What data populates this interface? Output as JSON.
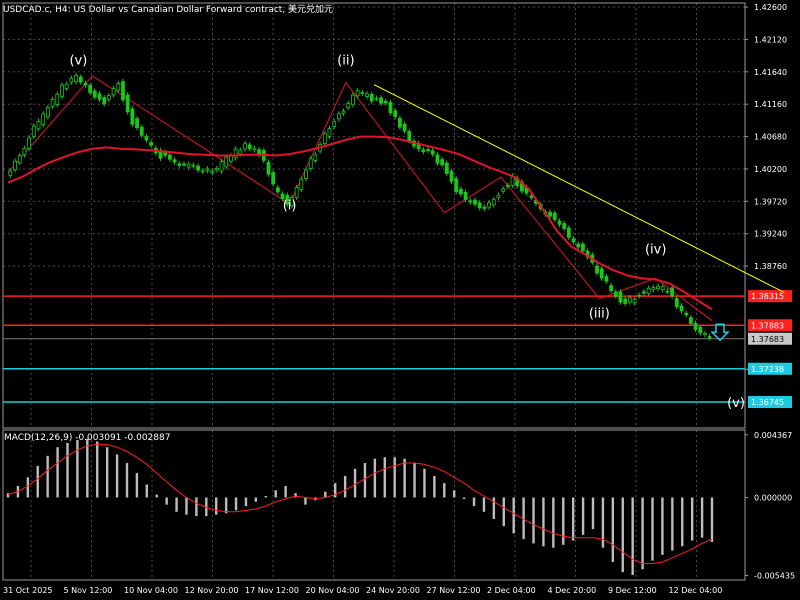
{
  "symbol_header": "USDCAD.c, H4:  US Dollar vs Canadian Dollar Forward contract, 美元兑加元",
  "macd_header": "MACD(12,26,9) -0.003091 -0.002887",
  "colors": {
    "background": "#000000",
    "grid": "#4a4a4a",
    "candles": "#19c819",
    "ma": "#e0142a",
    "wave_lines": "#e0142a",
    "trendline": "#ffff00",
    "resistance_lines": "#ff2020",
    "support_lines": "#1ecbe1",
    "macd_hist": "#bdbdbd",
    "macd_signal": "#ff2020",
    "axis_text": "#ffffff",
    "arrow": "#1ecbe1"
  },
  "chart_data": [
    {
      "type": "candlestick",
      "title": "USDCAD.c, H4:  US Dollar vs Canadian Dollar Forward contract, 美元兑加元",
      "x_tick_labels": [
        "31 Oct 2025",
        "5 Nov 12:00",
        "10 Nov 04:00",
        "12 Nov 20:00",
        "17 Nov 12:00",
        "20 Nov 04:00",
        "24 Nov 20:00",
        "27 Nov 12:00",
        "2 Dec 04:00",
        "4 Dec 20:00",
        "9 Dec 12:00",
        "12 Dec 04:00"
      ],
      "y_ticks": [
        {
          "v": 1.426,
          "label": "1.42600"
        },
        {
          "v": 1.4212,
          "label": "1.42120"
        },
        {
          "v": 1.4164,
          "label": "1.41640"
        },
        {
          "v": 1.4116,
          "label": "1.41160"
        },
        {
          "v": 1.4068,
          "label": "1.40680"
        },
        {
          "v": 1.402,
          "label": "1.40200"
        },
        {
          "v": 1.3972,
          "label": "1.39720"
        },
        {
          "v": 1.3924,
          "label": "1.39240"
        },
        {
          "v": 1.3876,
          "label": "1.38760"
        },
        {
          "v": 1.3723,
          "label": "1.37238"
        }
      ],
      "ylim": [
        1.3636,
        1.4266
      ],
      "price_series": [
        1.401,
        1.404,
        1.408,
        1.411,
        1.414,
        1.4155,
        1.4135,
        1.412,
        1.4145,
        1.409,
        1.406,
        1.404,
        1.403,
        1.4025,
        1.4015,
        1.402,
        1.404,
        1.4055,
        1.4045,
        1.3995,
        1.397,
        1.4005,
        1.4045,
        1.408,
        1.411,
        1.4135,
        1.4125,
        1.4115,
        1.4085,
        1.4055,
        1.4045,
        1.4025,
        1.399,
        1.397,
        1.396,
        1.3985,
        1.4005,
        1.398,
        1.396,
        1.3945,
        1.392,
        1.39,
        1.387,
        1.384,
        1.382,
        1.3835,
        1.3845,
        1.384,
        1.381,
        1.3782,
        1.3772
      ],
      "ma_series": [
        1.4,
        1.4008,
        1.402,
        1.403,
        1.4038,
        1.4045,
        1.405,
        1.4052,
        1.405,
        1.4049,
        1.4048,
        1.4046,
        1.4044,
        1.4042,
        1.4041,
        1.404,
        1.404,
        1.4041,
        1.4041,
        1.404,
        1.4042,
        1.4046,
        1.4051,
        1.4057,
        1.4063,
        1.4068,
        1.4068,
        1.4067,
        1.4063,
        1.4058,
        1.4053,
        1.4048,
        1.4042,
        1.4033,
        1.4024,
        1.4016,
        1.4008,
        1.399,
        1.396,
        1.3928,
        1.3905,
        1.3893,
        1.388,
        1.387,
        1.3862,
        1.3858,
        1.3856,
        1.385,
        1.3838,
        1.3825,
        1.3812
      ],
      "wave_labels": [
        {
          "label": "(v)",
          "index": 5,
          "price": 1.4175,
          "wave_low_high": 1.4155
        },
        {
          "label": "(i)",
          "index": 20,
          "price": 1.396,
          "wave_low_high": 1.397
        },
        {
          "label": "(ii)",
          "index": 24,
          "price": 1.4175,
          "wave_low_high": 1.4145
        },
        {
          "label": "(iii)",
          "index": 42,
          "price": 1.38,
          "wave_low_high": 1.3835
        },
        {
          "label": "(iv)",
          "index": 46,
          "price": 1.3895,
          "wave_low_high": 1.3865
        },
        {
          "label": "(v)",
          "index": 52,
          "price": 1.3667,
          "wave_low_high": 1.3667
        }
      ],
      "zigzag": [
        {
          "index": 0,
          "price": 1.4015
        },
        {
          "index": 6,
          "price": 1.4158
        },
        {
          "index": 20,
          "price": 1.3968
        },
        {
          "index": 24,
          "price": 1.4148
        },
        {
          "index": 31,
          "price": 1.3955
        },
        {
          "index": 35,
          "price": 1.4008
        },
        {
          "index": 42,
          "price": 1.3828
        },
        {
          "index": 46,
          "price": 1.3858
        },
        {
          "index": 50,
          "price": 1.3795
        }
      ],
      "trendline": {
        "from": {
          "index": 26,
          "price": 1.4145
        },
        "to": {
          "index": 53,
          "price": 1.3837
        }
      },
      "horizontal_levels": [
        {
          "price": 1.38315,
          "label": "1.38315",
          "kind": "resistance"
        },
        {
          "price": 1.37883,
          "label": "1.37883",
          "kind": "resistance"
        },
        {
          "price": 1.37683,
          "label": "1.37683",
          "kind": "current"
        },
        {
          "price": 1.37238,
          "label": "1.37238",
          "kind": "support"
        },
        {
          "price": 1.36745,
          "label": "1.36745",
          "kind": "support"
        }
      ],
      "grid": true
    },
    {
      "type": "bar",
      "title": "MACD(12,26,9) -0.003091 -0.002887",
      "y_ticks": [
        {
          "v": 0.004367,
          "label": "0.004367"
        },
        {
          "v": 0.0,
          "label": "0.000000"
        },
        {
          "v": -0.005435,
          "label": "-0.005435"
        }
      ],
      "ylim": [
        -0.00575,
        0.0047
      ],
      "histogram": [
        0.0003,
        0.0008,
        0.0014,
        0.0022,
        0.0029,
        0.0035,
        0.0038,
        0.004,
        0.0041,
        0.0039,
        0.0035,
        0.003,
        0.0024,
        0.0017,
        0.0009,
        0.0002,
        -0.0005,
        -0.001,
        -0.0012,
        -0.0013,
        -0.0013,
        -0.0012,
        -0.0011,
        -0.0009,
        -0.0006,
        -0.0003,
        0.0001,
        0.0005,
        0.0008,
        0.0003,
        -0.0005,
        -0.0002,
        0.0004,
        0.001,
        0.0015,
        0.002,
        0.0024,
        0.0027,
        0.0028,
        0.0028,
        0.0027,
        0.0024,
        0.002,
        0.0015,
        0.001,
        0.0005,
        -0.0001,
        -0.0006,
        -0.001,
        -0.0015,
        -0.002,
        -0.0025,
        -0.0029,
        -0.0032,
        -0.0034,
        -0.0035,
        -0.0033,
        -0.003,
        -0.0026,
        -0.0022,
        -0.0035,
        -0.0045,
        -0.0052,
        -0.0054,
        -0.005,
        -0.0044,
        -0.004,
        -0.0037,
        -0.0034,
        -0.003,
        -0.0028,
        -0.0031
      ],
      "signal": [
        0.0002,
        0.0004,
        0.0008,
        0.0013,
        0.0019,
        0.0024,
        0.0029,
        0.0033,
        0.0036,
        0.0037,
        0.0037,
        0.0035,
        0.0032,
        0.0028,
        0.0023,
        0.0017,
        0.0011,
        0.0005,
        0.0,
        -0.0004,
        -0.0007,
        -0.0009,
        -0.001,
        -0.001,
        -0.0009,
        -0.0008,
        -0.0006,
        -0.0003,
        -0.0001,
        0.0001,
        0.0,
        -0.0001,
        0.0,
        0.0002,
        0.0005,
        0.0009,
        0.0013,
        0.0017,
        0.002,
        0.0022,
        0.0024,
        0.0024,
        0.0023,
        0.0021,
        0.0018,
        0.0014,
        0.001,
        0.0005,
        0.0001,
        -0.0003,
        -0.0007,
        -0.0011,
        -0.0015,
        -0.0019,
        -0.0022,
        -0.0025,
        -0.0027,
        -0.0028,
        -0.0028,
        -0.0028,
        -0.0029,
        -0.0033,
        -0.0038,
        -0.0043,
        -0.0046,
        -0.0046,
        -0.0045,
        -0.0042,
        -0.0039,
        -0.0036,
        -0.0032,
        -0.0029
      ],
      "grid": true
    }
  ]
}
